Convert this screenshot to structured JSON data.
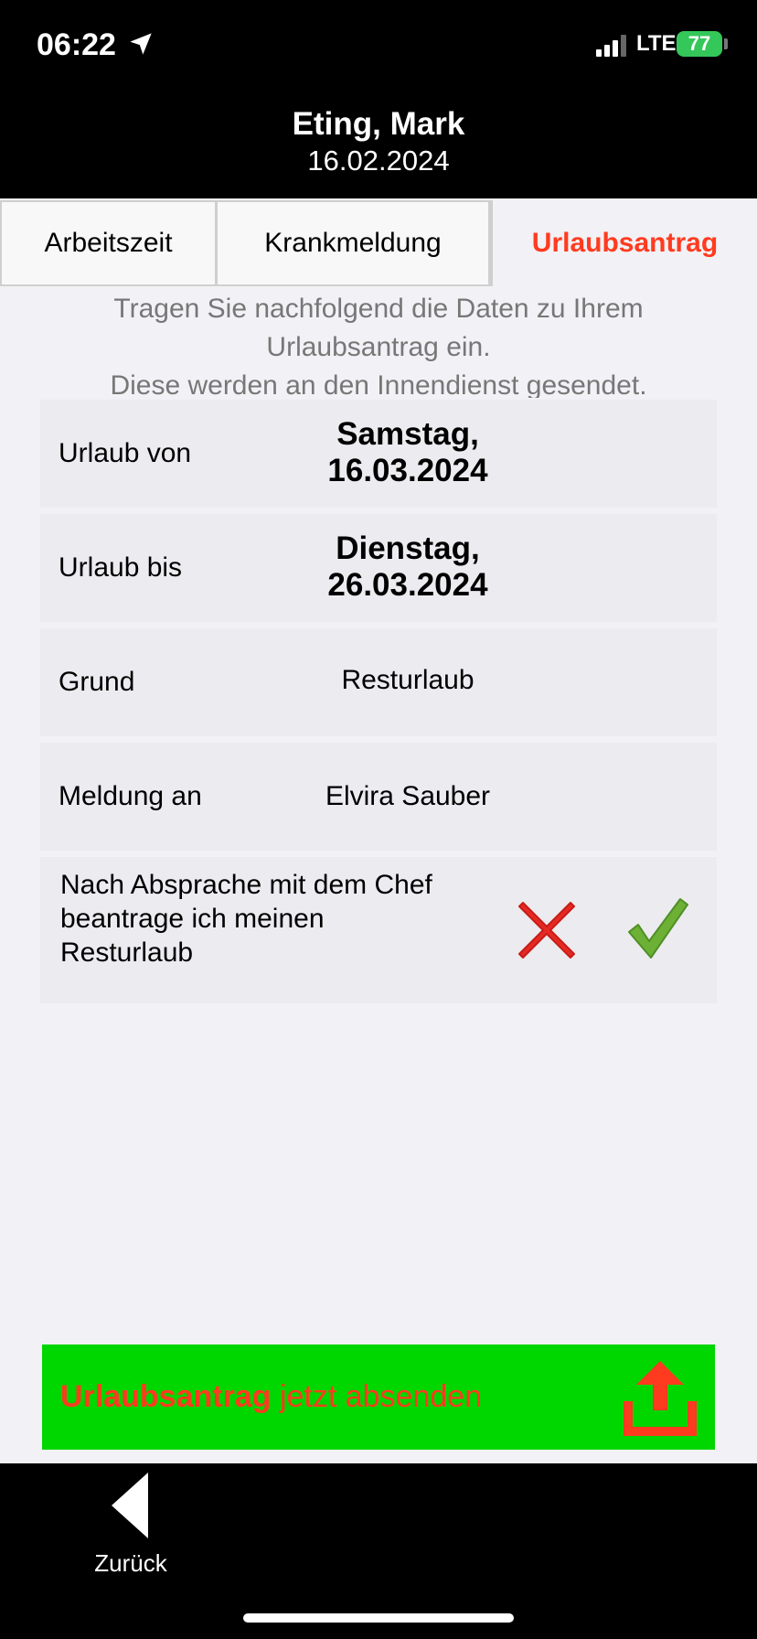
{
  "status_bar": {
    "time": "06:22",
    "network": "LTE",
    "battery": "77",
    "location_icon": "location-arrow-icon",
    "signal_icon": "signal-bars-icon"
  },
  "header": {
    "name": "Eting, Mark",
    "date": "16.02.2024"
  },
  "tabs": [
    {
      "label": "Arbeitszeit",
      "active": false
    },
    {
      "label": "Krankmeldung",
      "active": false
    },
    {
      "label": "Urlaubsantrag",
      "active": true
    }
  ],
  "intro": {
    "line1": "Tragen Sie nachfolgend die Daten zu Ihrem",
    "line2": "Urlaubsantrag ein.",
    "line3": "Diese werden an den Innendienst gesendet."
  },
  "form": {
    "from": {
      "label": "Urlaub von",
      "day": "Samstag,",
      "date": "16.03.2024"
    },
    "to": {
      "label": "Urlaub bis",
      "day": "Dienstag,",
      "date": "26.03.2024"
    },
    "reason": {
      "label": "Grund",
      "value": "Resturlaub"
    },
    "report_to": {
      "label": "Meldung an",
      "value": "Elvira Sauber"
    },
    "agreement": {
      "line1": "Nach Absprache mit dem Chef",
      "line2": "beantrage ich meinen",
      "line3": "Resturlaub",
      "reject_icon": "cross-icon",
      "accept_icon": "checkmark-icon"
    }
  },
  "submit": {
    "highlight": "Urlaubsantrag",
    "rest": " jetzt absenden",
    "icon": "upload-icon"
  },
  "bottom_nav": {
    "back_label": "Zurück"
  },
  "colors": {
    "accent": "#ff3b1f",
    "submit_bg": "#00d600",
    "battery": "#34c759",
    "content_bg": "#f2f1f5"
  }
}
